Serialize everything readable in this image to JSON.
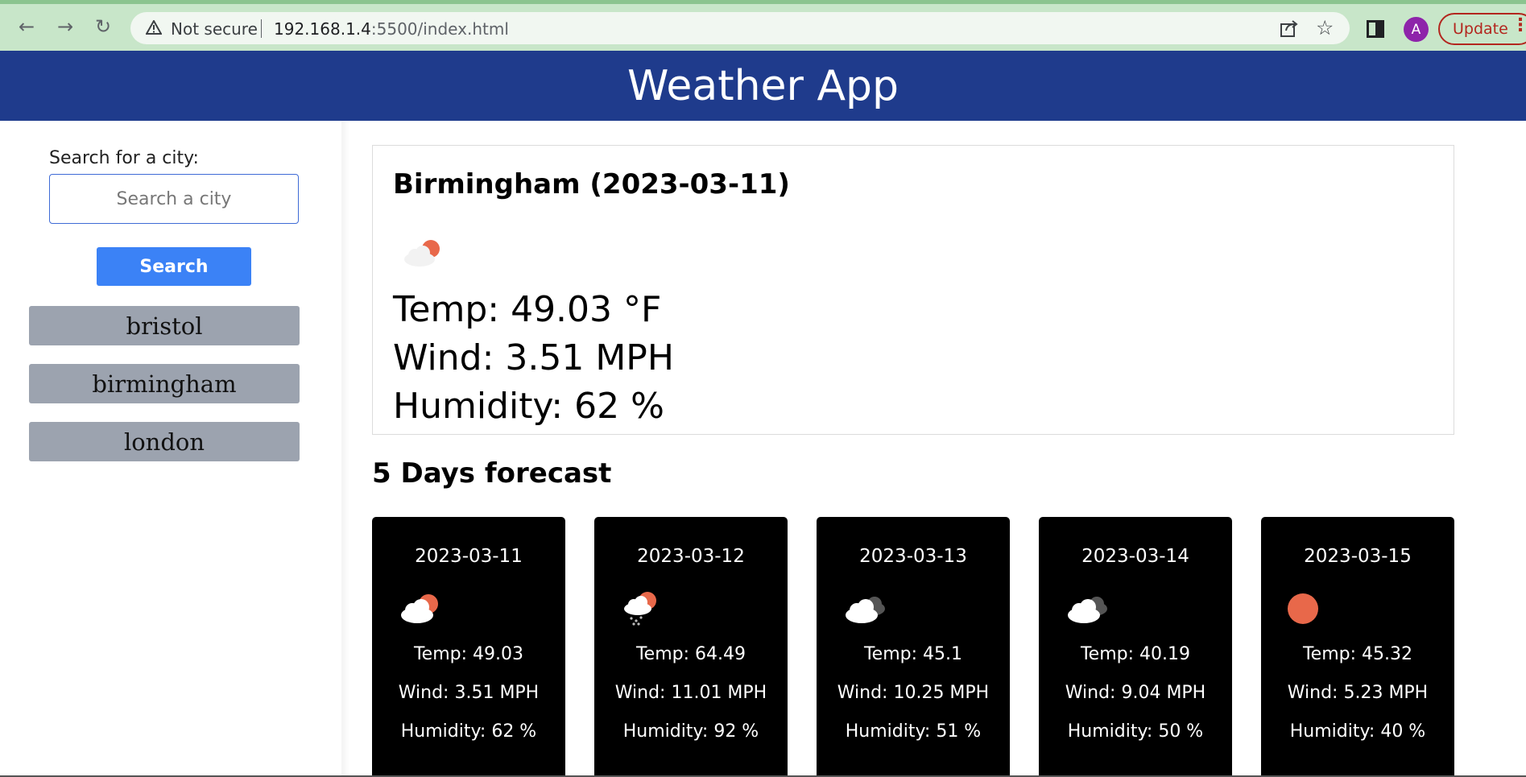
{
  "browser": {
    "security_label": "Not secure",
    "url_host": "192.168.1.4",
    "url_rest": ":5500/index.html",
    "avatar_letter": "A",
    "update_label": "Update"
  },
  "header": {
    "title": "Weather App"
  },
  "sidebar": {
    "search_label": "Search for a city:",
    "search_placeholder": "Search a city",
    "search_value": "",
    "search_button": "Search",
    "history": [
      "bristol",
      "birmingham",
      "london"
    ]
  },
  "current": {
    "title": "Birmingham (2023-03-11)",
    "icon": "cloud-sun-icon",
    "temp": "Temp: 49.03 °F",
    "wind": "Wind: 3.51 MPH",
    "humidity": "Humidity: 62 %"
  },
  "forecast": {
    "heading": "5 Days forecast",
    "days": [
      {
        "date": "2023-03-11",
        "icon": "cloud-sun-icon",
        "temp": "Temp: 49.03",
        "wind": "Wind: 3.51 MPH",
        "humidity": "Humidity: 62 %"
      },
      {
        "date": "2023-03-12",
        "icon": "snow-sun-icon",
        "temp": "Temp: 64.49",
        "wind": "Wind: 11.01 MPH",
        "humidity": "Humidity: 92 %"
      },
      {
        "date": "2023-03-13",
        "icon": "clouds-icon",
        "temp": "Temp: 45.1",
        "wind": "Wind: 10.25 MPH",
        "humidity": "Humidity: 51 %"
      },
      {
        "date": "2023-03-14",
        "icon": "clouds-icon",
        "temp": "Temp: 40.19",
        "wind": "Wind: 9.04 MPH",
        "humidity": "Humidity: 50 %"
      },
      {
        "date": "2023-03-15",
        "icon": "sun-icon",
        "temp": "Temp: 45.32",
        "wind": "Wind: 5.23 MPH",
        "humidity": "Humidity: 40 %"
      }
    ]
  },
  "colors": {
    "header_bg": "#1f3b8c",
    "search_button": "#3b82f6",
    "history_button": "#9ca3af",
    "forecast_card": "#000000",
    "sun": "#e8684a"
  }
}
